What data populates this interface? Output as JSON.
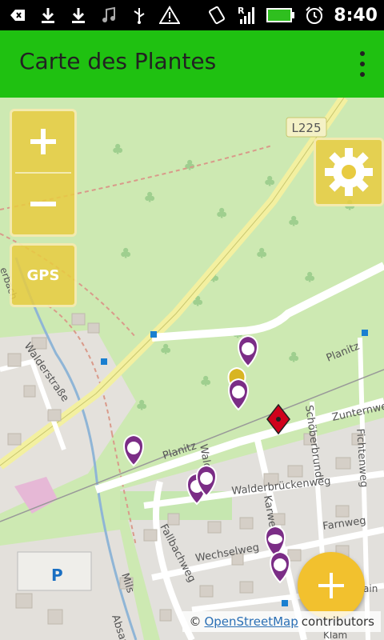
{
  "status_bar": {
    "time": "8:40",
    "notification_icons": [
      "back-notification-icon",
      "download-icon",
      "download-icon",
      "music-icon",
      "usb-icon",
      "warning-icon"
    ],
    "system_icons": [
      "rotation-icon",
      "roaming-signal-icon",
      "battery-icon",
      "alarm-icon"
    ]
  },
  "app_bar": {
    "title": "Carte des Plantes",
    "menu_icon": "overflow-menu-icon"
  },
  "map": {
    "controls": {
      "zoom_in_icon": "plus-icon",
      "zoom_out_icon": "minus-icon",
      "gps_label": "GPS",
      "settings_icon": "gear-icon"
    },
    "labels": {
      "road_badge": "L225",
      "walderstrasse": "Walderstraße",
      "planitz_1": "Planitz",
      "planitz_2": "Planitz",
      "schoberbrund": "Schöberbrundl",
      "zunternweg": "Zunternweg",
      "fichtenweg": "Fichtenweg",
      "walderbrueckenweg": "Walderbrückenweg",
      "karwe": "Karwe",
      "farnweg": "Farnweg",
      "wechselweg": "Wechselweg",
      "fallbachweg": "Fallbachweg",
      "walder": "Walder",
      "mils": "Mils",
      "absam": "Absam",
      "parking": "P",
      "bach": "erbach",
      "klam": "Klam",
      "rain": "ain"
    },
    "markers": {
      "plant_marker_icon": "purple-plant-marker-icon",
      "user_location_icon": "red-location-marker-icon"
    },
    "fab_icon": "plus-icon",
    "attribution": {
      "prefix": "©",
      "link": "OpenStreetMap",
      "suffix": "contributors"
    },
    "colors": {
      "app_bar": "#1fc111",
      "control_bg": "#e8cb40",
      "marker_purple": "#7b2d86",
      "marker_red": "#d0021b",
      "fab": "#f2c12e"
    }
  }
}
